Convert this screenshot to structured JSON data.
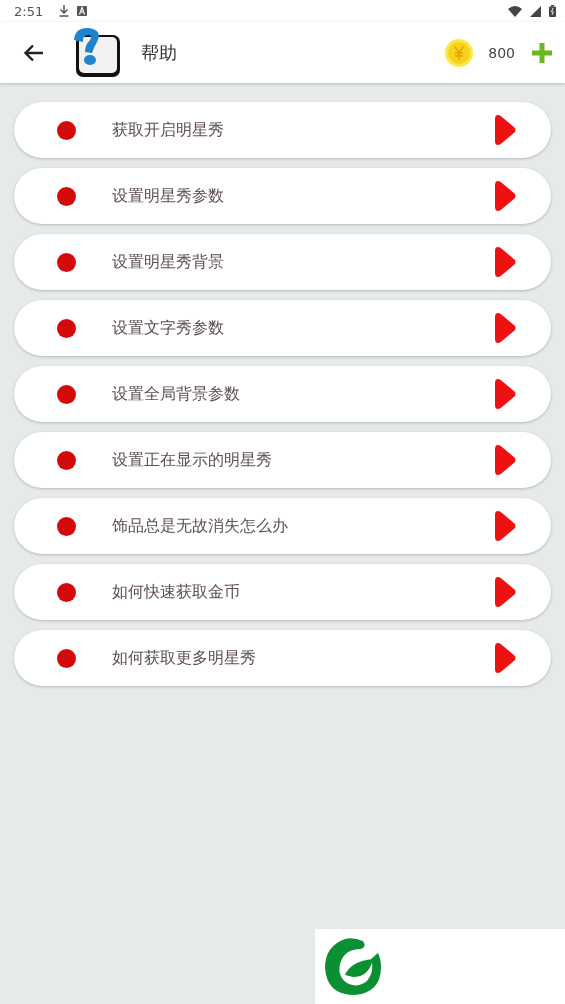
{
  "status_bar": {
    "time": "2:51"
  },
  "header": {
    "title": "帮助",
    "coins": "800"
  },
  "items": [
    {
      "label": "获取开启明星秀"
    },
    {
      "label": "设置明星秀参数"
    },
    {
      "label": "设置明星秀背景"
    },
    {
      "label": "设置文字秀参数"
    },
    {
      "label": "设置全局背景参数"
    },
    {
      "label": "设置正在显示的明星秀"
    },
    {
      "label": "饰品总是无故消失怎么办"
    },
    {
      "label": "如何快速获取金币"
    },
    {
      "label": "如何获取更多明星秀"
    }
  ]
}
